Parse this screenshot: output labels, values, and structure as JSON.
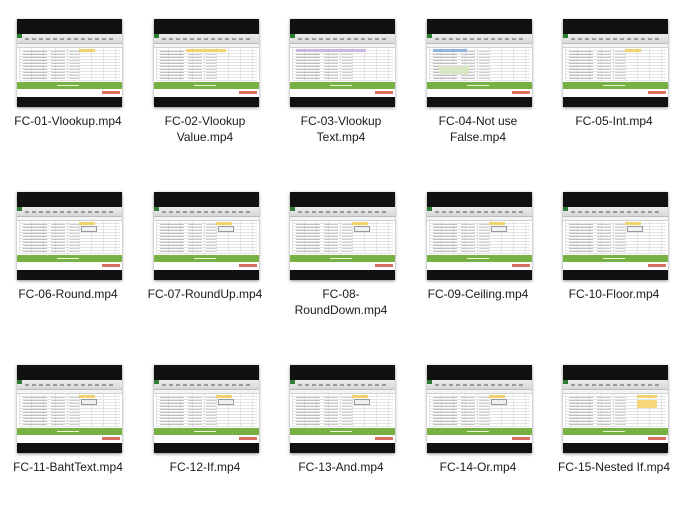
{
  "files": [
    {
      "name": "FC-01-Vlookup.mp4",
      "variant": "list"
    },
    {
      "name": "FC-02-Vlookup Value.mp4",
      "variant": "yellowhead"
    },
    {
      "name": "FC-03-Vlookup Text.mp4",
      "variant": "purplehead"
    },
    {
      "name": "FC-04-Not use False.mp4",
      "variant": "table"
    },
    {
      "name": "FC-05-Int.mp4",
      "variant": "list"
    },
    {
      "name": "FC-06-Round.mp4",
      "variant": "sheet"
    },
    {
      "name": "FC-07-RoundUp.mp4",
      "variant": "sheet"
    },
    {
      "name": "FC-08-RoundDown.mp4",
      "variant": "sheet"
    },
    {
      "name": "FC-09-Ceiling.mp4",
      "variant": "sheet"
    },
    {
      "name": "FC-10-Floor.mp4",
      "variant": "sheet"
    },
    {
      "name": "FC-11-BahtText.mp4",
      "variant": "sheet"
    },
    {
      "name": "FC-12-If.mp4",
      "variant": "sheet"
    },
    {
      "name": "FC-13-And.mp4",
      "variant": "sheet"
    },
    {
      "name": "FC-14-Or.mp4",
      "variant": "sheet"
    },
    {
      "name": "FC-15-Nested If.mp4",
      "variant": "nested"
    }
  ],
  "labels_display": [
    "FC-01-Vlookup.mp4",
    "FC-02-Vlookup\nValue.mp4",
    "FC-03-Vlookup\nText.mp4",
    "FC-04-Not use\nFalse.mp4",
    "FC-05-Int.mp4",
    "FC-06-Round.mp4",
    "FC-07-RoundUp.mp4",
    "FC-08-\nRoundDown.mp4",
    "FC-09-Ceiling.mp4",
    "FC-10-Floor.mp4",
    "FC-11-BahtText.mp4",
    "FC-12-If.mp4",
    "FC-13-And.mp4",
    "FC-14-Or.mp4",
    "FC-15-Nested If.mp4"
  ],
  "colors": {
    "excel_green": "#77b043",
    "brand_red": "#d24a3c",
    "highlight_yellow": "#f2d36b"
  }
}
